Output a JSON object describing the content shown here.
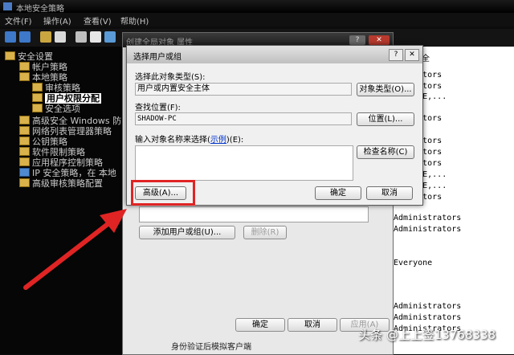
{
  "window": {
    "title": "本地安全策略"
  },
  "menu": [
    "文件(F)",
    "操作(A)",
    "查看(V)",
    "帮助(H)"
  ],
  "tree": {
    "items": [
      {
        "label": "安全设置"
      },
      {
        "label": "帐户策略"
      },
      {
        "label": "本地策略"
      },
      {
        "label": "审核策略"
      },
      {
        "label": "用户权限分配",
        "selected": true
      },
      {
        "label": "安全选项"
      },
      {
        "label": "高级安全 Windows 防"
      },
      {
        "label": "网络列表管理器策略"
      },
      {
        "label": "公钥策略"
      },
      {
        "label": "软件限制策略"
      },
      {
        "label": "应用程序控制策略"
      },
      {
        "label": "IP 安全策略，在 本地"
      },
      {
        "label": "高级审核策略配置"
      }
    ]
  },
  "right_list": {
    "header": "全",
    "rows": [
      "nistrators",
      "nistrators",
      "SERVICE,...",
      "nistrators",
      "nistrators",
      "nistrators",
      "nistrators",
      "SERVICE,...",
      "SERVICE,...",
      "nistrators",
      "Administrators",
      "Administrators",
      "Everyone",
      "Administrators",
      "Administrators",
      "Administrators"
    ]
  },
  "prop_dialog": {
    "title": "创建全局对象 属性",
    "add_button": "添加用户或组(U)...",
    "remove_button": "删除(R)",
    "ok": "确定",
    "cancel": "取消",
    "apply": "应用(A)",
    "bottom_text": "身份验证后模拟客户端"
  },
  "select_dialog": {
    "title": "选择用户或组",
    "object_type_label": "选择此对象类型(S):",
    "object_type_value": "用户或内置安全主体",
    "object_type_button": "对象类型(O)...",
    "location_label": "查找位置(F):",
    "location_value": "SHADOW-PC",
    "location_button": "位置(L)...",
    "names_label_pre": "输入对象名称来选择(",
    "names_label_link": "示例",
    "names_label_post": ")(E):",
    "check_names_button": "检查名称(C)",
    "advanced_button": "高级(A)...",
    "ok": "确定",
    "cancel": "取消"
  },
  "watermark": "头条 @上上签13768338",
  "colors": {
    "highlight": "#e02424",
    "arrow": "#e02424"
  }
}
